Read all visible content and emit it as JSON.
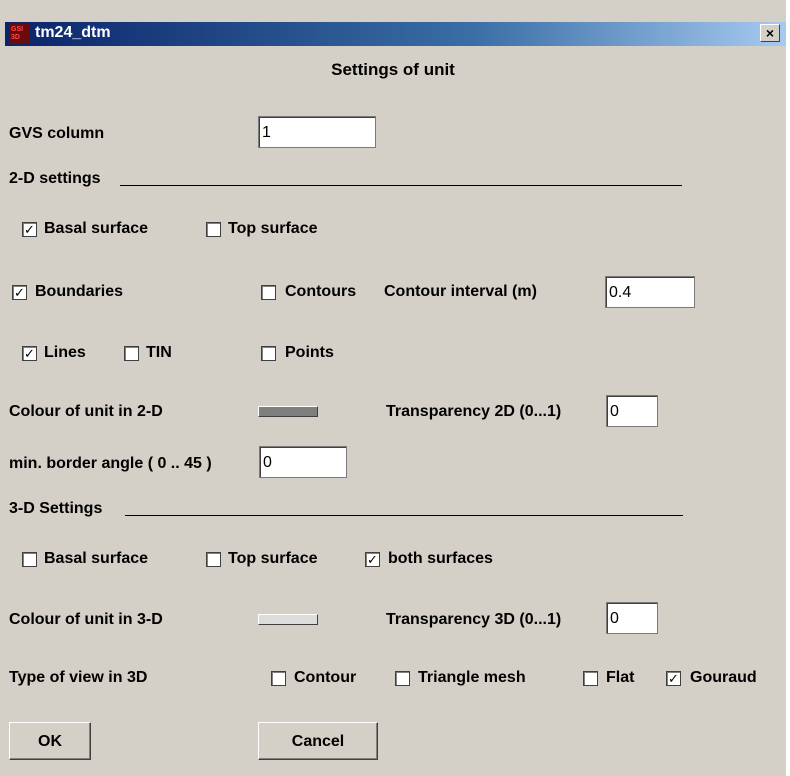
{
  "window": {
    "title": "tm24_dtm",
    "close_label": "×"
  },
  "heading": "Settings of unit",
  "gvs": {
    "label": "GVS column",
    "value": "1"
  },
  "settings_2d": {
    "section_label": "2-D settings",
    "basal_surface": {
      "label": "Basal surface",
      "checked": true
    },
    "top_surface": {
      "label": "Top surface",
      "checked": false
    },
    "boundaries": {
      "label": "Boundaries",
      "checked": true
    },
    "contours": {
      "label": "Contours",
      "checked": false
    },
    "contour_interval": {
      "label": "Contour interval (m)",
      "value": "0.4"
    },
    "lines": {
      "label": "Lines",
      "checked": true
    },
    "tin": {
      "label": "TIN",
      "checked": false
    },
    "points": {
      "label": "Points",
      "checked": false
    },
    "colour_label": "Colour of unit in 2-D",
    "colour": "#7f7f7f",
    "transparency": {
      "label": "Transparency 2D (0...1)",
      "value": "0"
    },
    "border_angle": {
      "label": "min. border angle ( 0 .. 45 )",
      "value": "0"
    }
  },
  "settings_3d": {
    "section_label": "3-D Settings",
    "basal_surface": {
      "label": "Basal surface",
      "checked": false
    },
    "top_surface": {
      "label": "Top surface",
      "checked": false
    },
    "both_surfaces": {
      "label": "both surfaces",
      "checked": true
    },
    "colour_label": "Colour of unit in 3-D",
    "colour": "#dcdcdc",
    "transparency": {
      "label": "Transparency 3D (0...1)",
      "value": "0"
    },
    "view_label": "Type of view in 3D",
    "contour": {
      "label": "Contour",
      "checked": false
    },
    "triangle_mesh": {
      "label": "Triangle mesh",
      "checked": false
    },
    "flat": {
      "label": "Flat",
      "checked": false
    },
    "gouraud": {
      "label": "Gouraud",
      "checked": true
    }
  },
  "buttons": {
    "ok": "OK",
    "cancel": "Cancel"
  }
}
